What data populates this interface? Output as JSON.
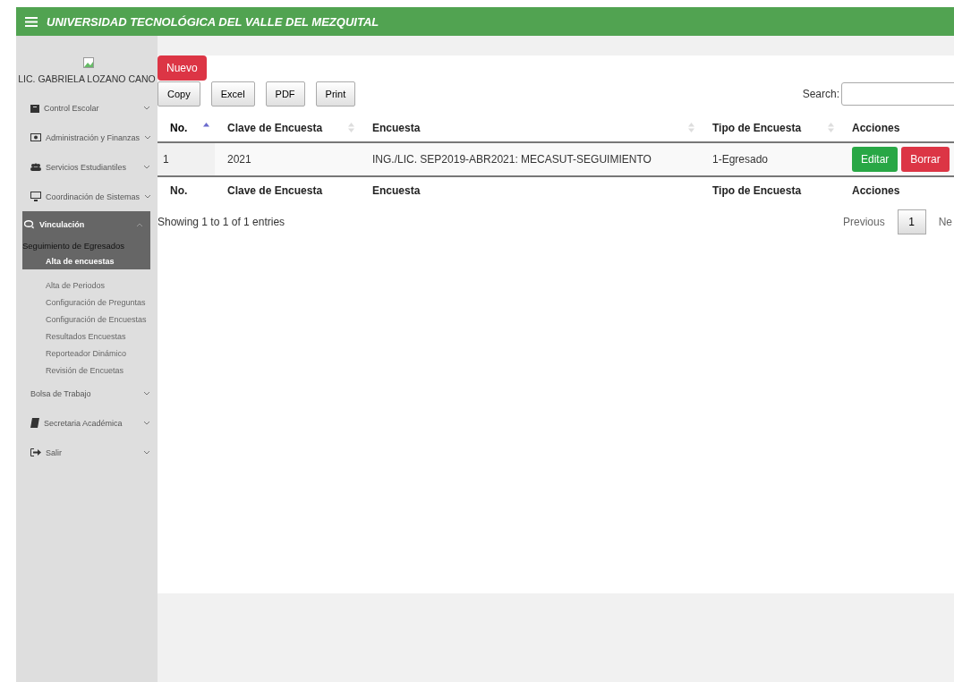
{
  "header": {
    "title": "UNIVERSIDAD TECNOLÓGICA DEL VALLE DEL MEZQUITAL"
  },
  "sidebar": {
    "user": "LIC. GABRIELA LOZANO CANO",
    "items": [
      {
        "label": "Control Escolar",
        "expanded": false,
        "selected": false
      },
      {
        "label": "Administración y Finanzas",
        "expanded": false,
        "selected": false
      },
      {
        "label": "Servicios Estudiantiles",
        "expanded": false,
        "selected": false
      },
      {
        "label": "Coordinación de Sistemas",
        "expanded": false,
        "selected": false
      },
      {
        "label": "Vinculación",
        "expanded": true,
        "selected": true,
        "children": [
          {
            "label": "Seguimiento de Egresados",
            "expanded": true,
            "selected": true,
            "children": [
              {
                "label": "Alta de encuestas",
                "selected": true
              },
              {
                "label": "Alta de Periodos",
                "selected": false
              },
              {
                "label": "Configuración de Preguntas",
                "selected": false
              },
              {
                "label": "Configuración de Encuestas",
                "selected": false
              },
              {
                "label": "Resultados Encuestas",
                "selected": false
              },
              {
                "label": "Reporteador Dinámico",
                "selected": false
              },
              {
                "label": "Revisión de Encuetas",
                "selected": false
              }
            ]
          }
        ]
      },
      {
        "label": "Bolsa de Trabajo",
        "expanded": false,
        "selected": false
      },
      {
        "label": "Secretaria Académica",
        "expanded": false,
        "selected": false
      },
      {
        "label": "Salir",
        "expanded": false,
        "selected": false
      }
    ]
  },
  "new_button": "Nuevo",
  "export_buttons": [
    "Copy",
    "Excel",
    "PDF",
    "Print"
  ],
  "search": {
    "label": "Search:"
  },
  "table": {
    "columns": [
      {
        "label": "No.",
        "sortable": true,
        "sorted": true
      },
      {
        "label": "Clave de Encuesta",
        "sortable": true,
        "sorted": false
      },
      {
        "label": "Encuesta",
        "sortable": true,
        "sorted": false
      },
      {
        "label": "Tipo de Encuesta",
        "sortable": true,
        "sorted": false
      },
      {
        "label": "Acciones",
        "sortable": false,
        "sorted": false
      }
    ],
    "rows": [
      {
        "cells": [
          "1",
          "2021",
          "ING./LIC. SEP2019-ABR2021: MECASUT-SEGUIMIENTO",
          "1-Egresado"
        ],
        "actions": [
          {
            "label": "Editar",
            "kind": "edit"
          },
          {
            "label": "Borrar",
            "kind": "delete"
          }
        ]
      }
    ],
    "footer": [
      "No.",
      "Clave de Encuesta",
      "Encuesta",
      "Tipo de Encuesta",
      "Acciones"
    ]
  },
  "info": "Showing 1 to 1 of 1 entries",
  "pagination": {
    "previous": "Previous",
    "pages": [
      {
        "label": "1",
        "selected": true
      }
    ],
    "next": "Ne"
  }
}
